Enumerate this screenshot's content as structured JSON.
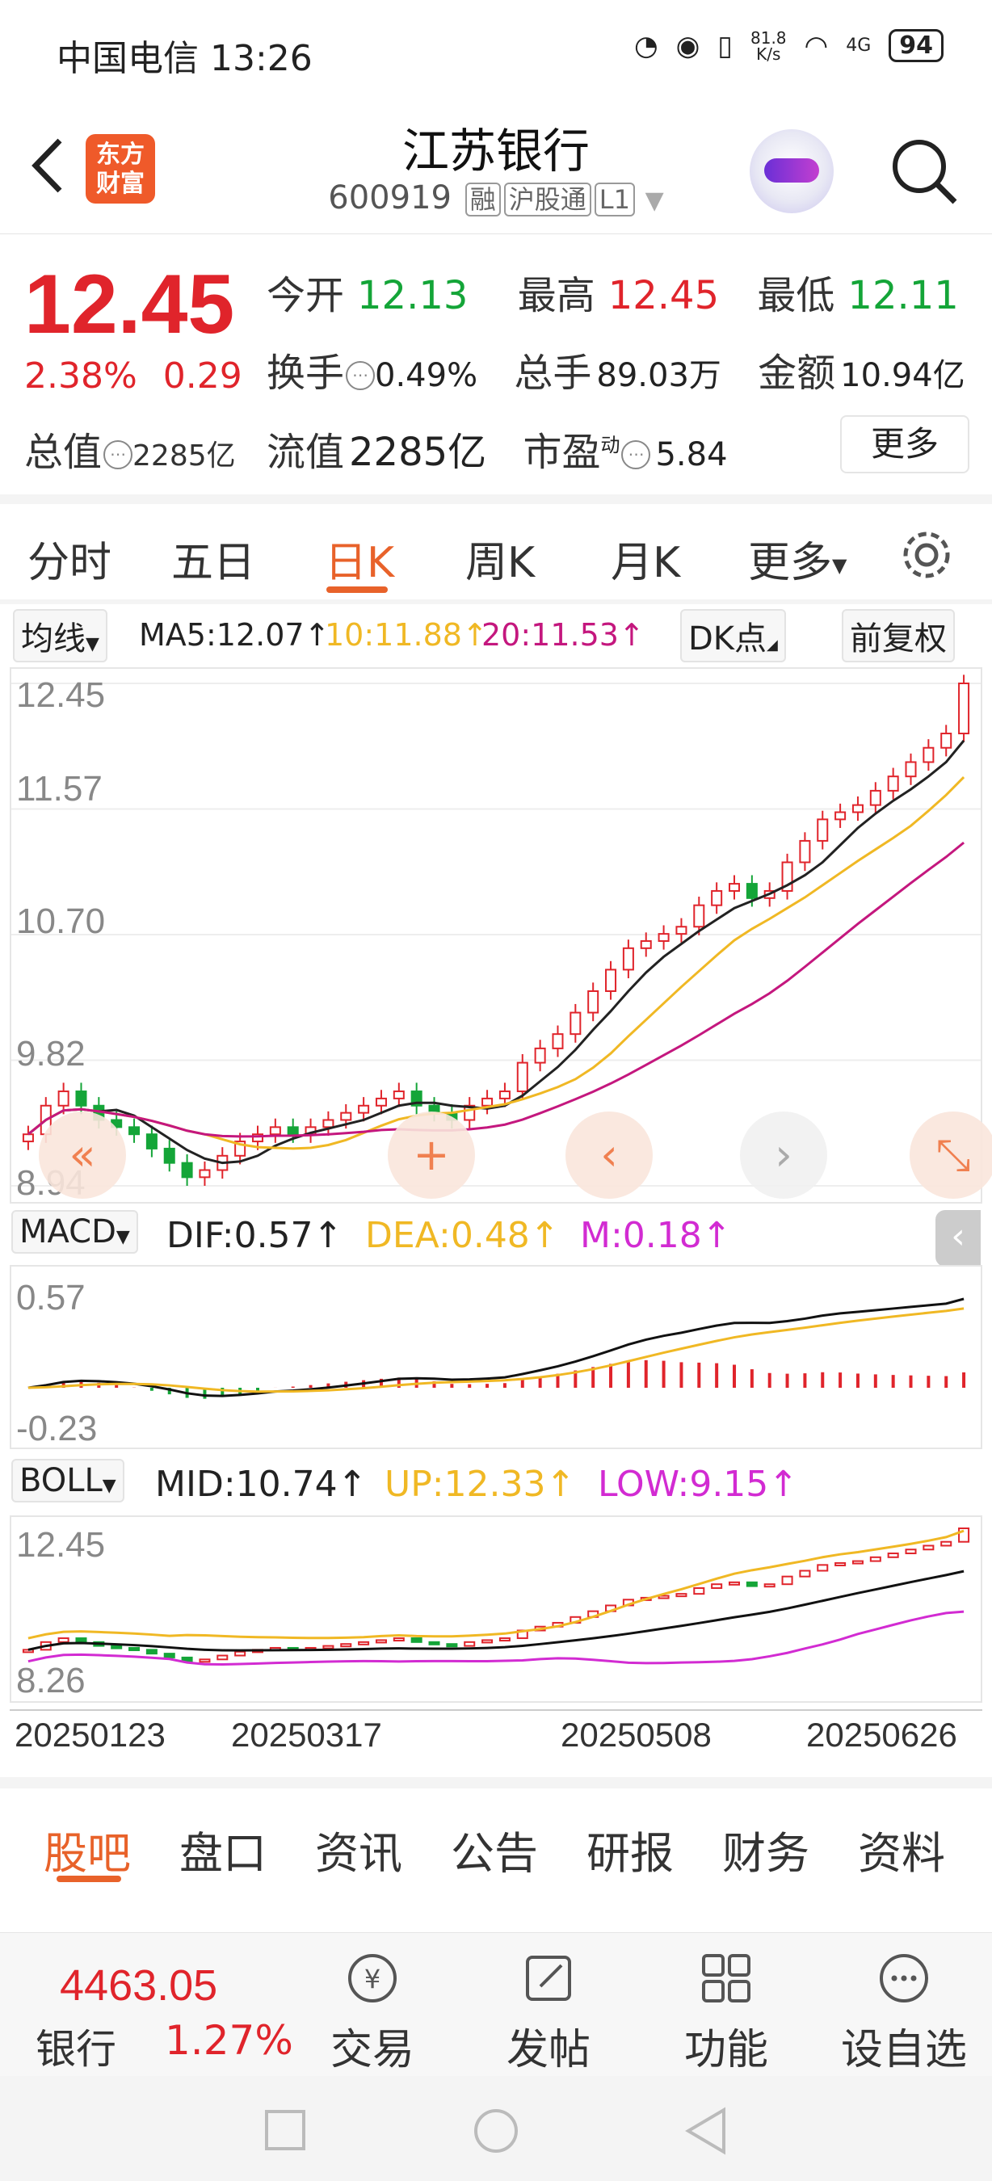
{
  "status_bar": {
    "carrier_time": "中国电信 13:26",
    "net_speed_value": "81.8",
    "net_speed_unit": "K/s",
    "network": "4G",
    "battery": "94"
  },
  "header": {
    "logo_text": "东方财富",
    "stock_name": "江苏银行",
    "stock_code": "600919",
    "tags": [
      "融",
      "沪股通",
      "L1"
    ]
  },
  "quote": {
    "price": "12.45",
    "change_pct": "2.38%",
    "change_abs": "0.29",
    "open_label": "今开",
    "open": "12.13",
    "high_label": "最高",
    "high": "12.45",
    "low_label": "最低",
    "low": "12.11",
    "turnover_label": "换手",
    "turnover": "0.49%",
    "volume_label": "总手",
    "volume": "89.03万",
    "amount_label": "金额",
    "amount": "10.94亿",
    "total_value_label": "总值",
    "total_value": "2285亿",
    "float_value_label": "流值",
    "float_value": "2285亿",
    "pe_label": "市盈",
    "pe_sup": "动",
    "pe": "5.84",
    "more_label": "更多"
  },
  "period_tabs": [
    "分时",
    "五日",
    "日K",
    "周K",
    "月K",
    "更多"
  ],
  "active_period": "日K",
  "ma_legend": {
    "selector": "均线",
    "ma5": "MA5:12.07↑",
    "ma10": "10:11.88↑",
    "ma20": "20:11.53↑",
    "dk": "DK点",
    "adjust": "前复权"
  },
  "kline_axis": [
    "12.45",
    "11.57",
    "10.70",
    "9.82",
    "8.94"
  ],
  "macd": {
    "selector": "MACD",
    "dif": "DIF:0.57↑",
    "dea": "DEA:0.48↑",
    "m": "M:0.18↑",
    "axis_top": "0.57",
    "axis_bottom": "-0.23"
  },
  "boll": {
    "selector": "BOLL",
    "mid": "MID:10.74↑",
    "up": "UP:12.33↑",
    "low": "LOW:9.15↑",
    "axis_top": "12.45",
    "axis_bottom": "8.26"
  },
  "dates": [
    "20250123",
    "20250317",
    "20250508",
    "20250626"
  ],
  "bottom_tabs": [
    "股吧",
    "盘口",
    "资讯",
    "公告",
    "研报",
    "财务",
    "资料"
  ],
  "toolbar": {
    "index_value": "4463.05",
    "index_name": "银行",
    "index_pct": "1.27%",
    "trade": "交易",
    "post": "发帖",
    "function": "功能",
    "watchlist": "设自选"
  },
  "colors": {
    "up": "#e0242b",
    "down": "#14a538",
    "accent": "#e8622a",
    "ma10": "#f0b824",
    "ma20": "#c4177e"
  },
  "chart_data": {
    "type": "candlestick",
    "ylim": [
      8.94,
      12.45
    ],
    "close_approx": [
      9.3,
      9.5,
      9.6,
      9.5,
      9.4,
      9.35,
      9.3,
      9.2,
      9.1,
      9.0,
      9.05,
      9.15,
      9.25,
      9.3,
      9.35,
      9.3,
      9.35,
      9.4,
      9.45,
      9.5,
      9.55,
      9.6,
      9.5,
      9.45,
      9.4,
      9.5,
      9.55,
      9.6,
      9.8,
      9.9,
      10.0,
      10.15,
      10.3,
      10.45,
      10.6,
      10.65,
      10.7,
      10.75,
      10.9,
      11.0,
      11.05,
      10.95,
      11.0,
      11.2,
      11.35,
      11.5,
      11.55,
      11.6,
      11.7,
      11.8,
      11.9,
      12.0,
      12.1,
      12.45
    ]
  }
}
